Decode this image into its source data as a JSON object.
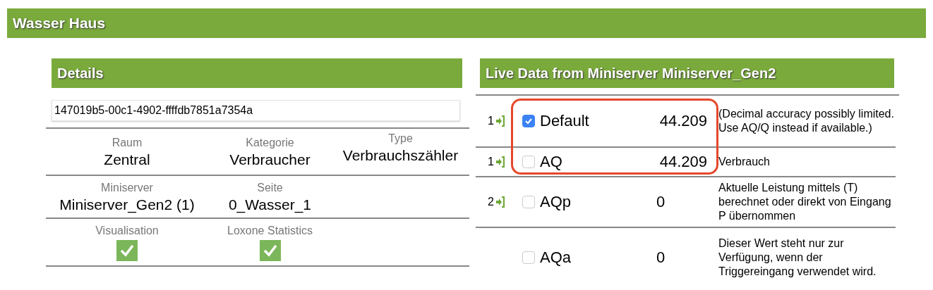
{
  "title": "Wasser Haus",
  "details": {
    "header": "Details",
    "uuid": "147019b5-00c1-4902-ffffdb7851a7354a",
    "rows": [
      {
        "cells": [
          {
            "label": "Raum",
            "value": "Zentral"
          },
          {
            "label": "Kategorie",
            "value": "Verbraucher"
          },
          {
            "label": "Type",
            "value": "Verbrauchszähler"
          }
        ]
      },
      {
        "cells": [
          {
            "label": "Miniserver",
            "value": "Miniserver_Gen2 (1)"
          },
          {
            "label": "Seite",
            "value": "0_Wasser_1"
          }
        ]
      },
      {
        "cells": [
          {
            "label": "Visualisation",
            "checked": true
          },
          {
            "label": "Loxone Statistics",
            "checked": true
          }
        ]
      }
    ]
  },
  "live": {
    "header": "Live Data from Miniserver Miniserver_Gen2",
    "rows": [
      {
        "count": "1",
        "checked": true,
        "highlighted": true,
        "name": "Default",
        "value": "44.209",
        "description": "(Decimal accuracy possibly limited. Use AQ/Q instead if available.)"
      },
      {
        "count": "1",
        "checked": false,
        "highlighted": true,
        "name": "AQ",
        "value": "44.209",
        "description": "Verbrauch"
      },
      {
        "count": "2",
        "checked": false,
        "highlighted": false,
        "name": "AQp",
        "value": "0",
        "description": "Aktuelle Leistung mittels (T) berechnet oder direkt von Eingang P übernommen"
      },
      {
        "checked": false,
        "highlighted": false,
        "name": "AQa",
        "value": "0",
        "description": "Dieser Wert steht nur zur Verfügung, wenn der Triggereingang verwendet wird."
      }
    ]
  }
}
